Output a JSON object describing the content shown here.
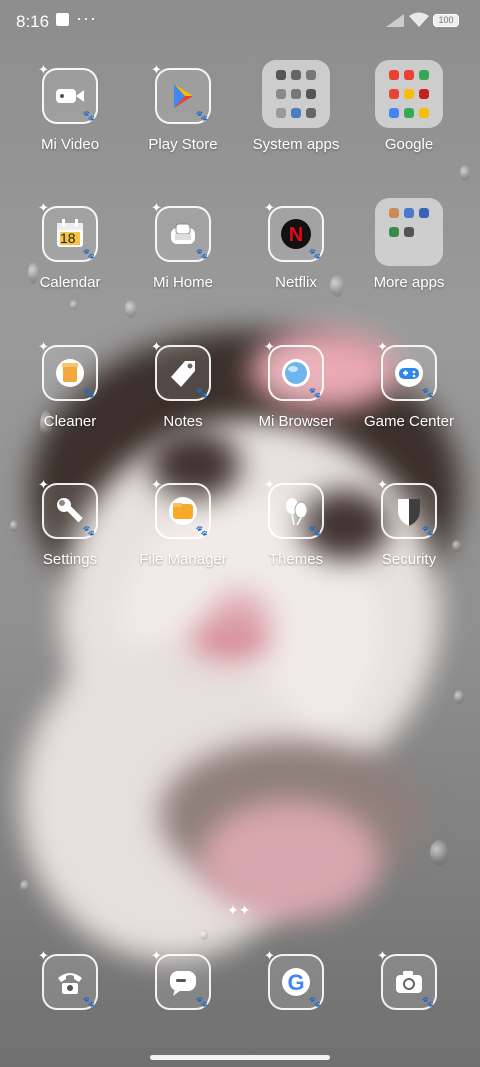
{
  "status_bar": {
    "time": "8:16",
    "notification_dots": "···",
    "battery": "100"
  },
  "apps": [
    {
      "name": "mi-video",
      "label": "Mi Video"
    },
    {
      "name": "play-store",
      "label": "Play Store"
    },
    {
      "name": "system-apps",
      "label": "System apps"
    },
    {
      "name": "google-folder",
      "label": "Google"
    },
    {
      "name": "calendar",
      "label": "Calendar",
      "date": "18"
    },
    {
      "name": "mi-home",
      "label": "Mi Home"
    },
    {
      "name": "netflix",
      "label": "Netflix"
    },
    {
      "name": "more-apps",
      "label": "More apps"
    },
    {
      "name": "cleaner",
      "label": "Cleaner"
    },
    {
      "name": "notes",
      "label": "Notes"
    },
    {
      "name": "mi-browser",
      "label": "Mi Browser"
    },
    {
      "name": "game-center",
      "label": "Game Center"
    },
    {
      "name": "settings",
      "label": "Settings"
    },
    {
      "name": "file-manager",
      "label": "File Manager"
    },
    {
      "name": "themes",
      "label": "Themes"
    },
    {
      "name": "security",
      "label": "Security"
    }
  ],
  "dock": [
    "phone",
    "messages",
    "google",
    "camera"
  ],
  "colors": {
    "netflix": "#e50914",
    "folder_bg": "#d7d7d7",
    "text": "#ffffff"
  }
}
